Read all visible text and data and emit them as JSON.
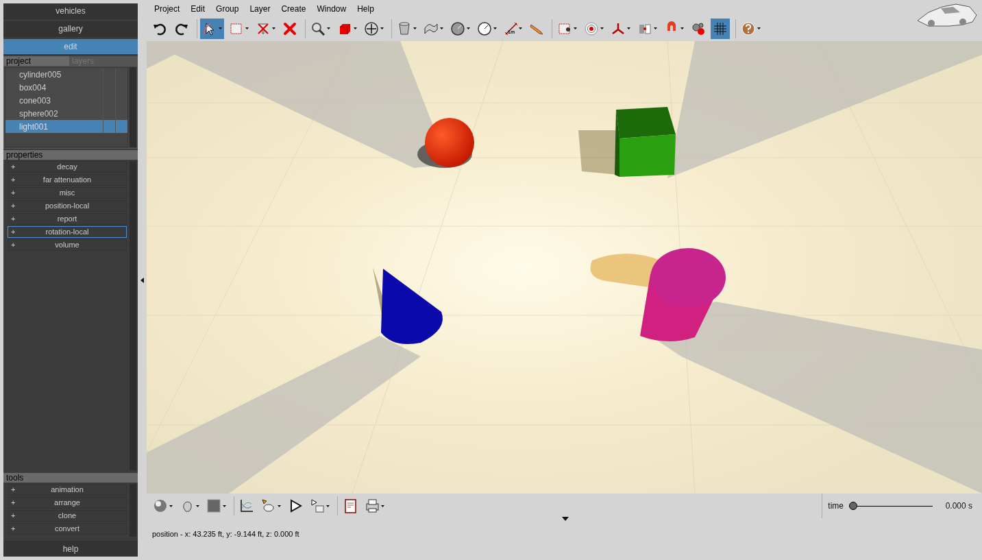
{
  "nav": [
    {
      "label": "vehicles",
      "selected": false
    },
    {
      "label": "gallery",
      "selected": false
    },
    {
      "label": "edit",
      "selected": true
    }
  ],
  "panel_tabs": [
    {
      "label": "project",
      "selected": true
    },
    {
      "label": "layers",
      "selected": false
    }
  ],
  "project_items": [
    {
      "label": "cylinder005",
      "selected": false
    },
    {
      "label": "box004",
      "selected": false
    },
    {
      "label": "cone003",
      "selected": false
    },
    {
      "label": "sphere002",
      "selected": false
    },
    {
      "label": "light001",
      "selected": true
    }
  ],
  "properties": {
    "title": "properties",
    "items": [
      {
        "label": "decay",
        "focused": false
      },
      {
        "label": "far attenuation",
        "focused": false
      },
      {
        "label": "misc",
        "focused": false
      },
      {
        "label": "position-local",
        "focused": false
      },
      {
        "label": "report",
        "focused": false
      },
      {
        "label": "rotation-local",
        "focused": true
      },
      {
        "label": "volume",
        "focused": false
      }
    ]
  },
  "tools": {
    "title": "tools",
    "items": [
      {
        "label": "animation",
        "focused": false
      },
      {
        "label": "arrange",
        "focused": false
      },
      {
        "label": "clone",
        "focused": false
      },
      {
        "label": "convert",
        "focused": false
      }
    ]
  },
  "expand_sign": "+",
  "help": "help",
  "menu": [
    "Project",
    "Edit",
    "Group",
    "Layer",
    "Create",
    "Window",
    "Help"
  ],
  "toolbar": [
    {
      "selected": false
    },
    {
      "selected": false
    },
    {
      "selected": true
    },
    {
      "selected": false
    },
    {
      "selected": false
    },
    {
      "selected": false
    },
    {
      "selected": false
    },
    {
      "selected": false
    },
    {
      "selected": false
    },
    {
      "selected": false
    },
    {
      "selected": false
    },
    {
      "selected": false
    },
    {
      "selected": false
    },
    {
      "selected": false
    },
    {
      "selected": false
    },
    {
      "selected": false
    },
    {
      "selected": false
    },
    {
      "selected": false
    },
    {
      "selected": false
    },
    {
      "selected": false
    },
    {
      "selected": false
    },
    {
      "selected": true
    }
  ],
  "ruler_label": "1m",
  "time": {
    "label": "time",
    "level": 0,
    "reading": "0.000 s"
  },
  "status": "position - x: 43.235 ft, y: -9.144 ft, z: 0.000 ft"
}
